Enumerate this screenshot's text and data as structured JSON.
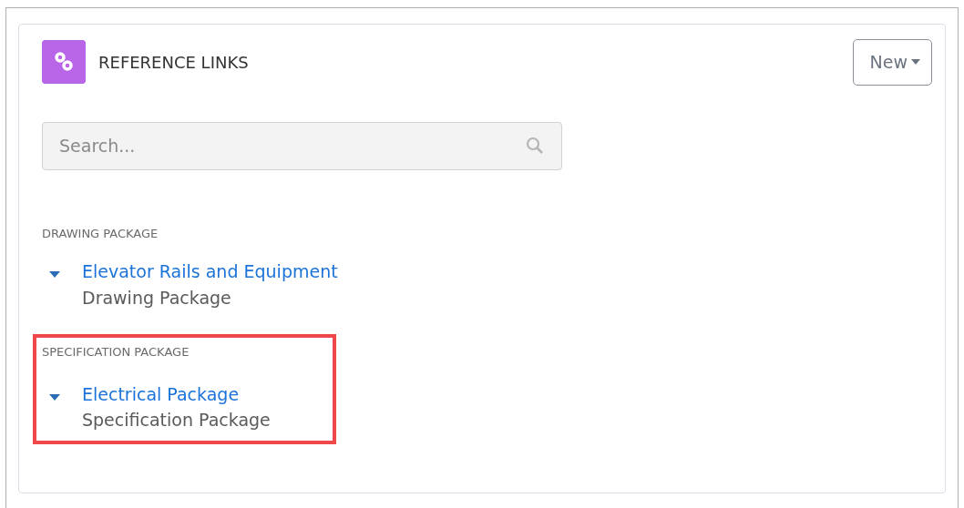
{
  "header": {
    "title": "REFERENCE LINKS",
    "new_button": "New"
  },
  "search": {
    "placeholder": "Search..."
  },
  "groups": [
    {
      "label": "DRAWING PACKAGE",
      "highlighted": false,
      "items": [
        {
          "title": "Elevator Rails and Equipment",
          "subtitle": "Drawing Package"
        }
      ]
    },
    {
      "label": "SPECIFICATION PACKAGE",
      "highlighted": true,
      "items": [
        {
          "title": "Electrical Package",
          "subtitle": "Specification Package"
        }
      ]
    }
  ]
}
